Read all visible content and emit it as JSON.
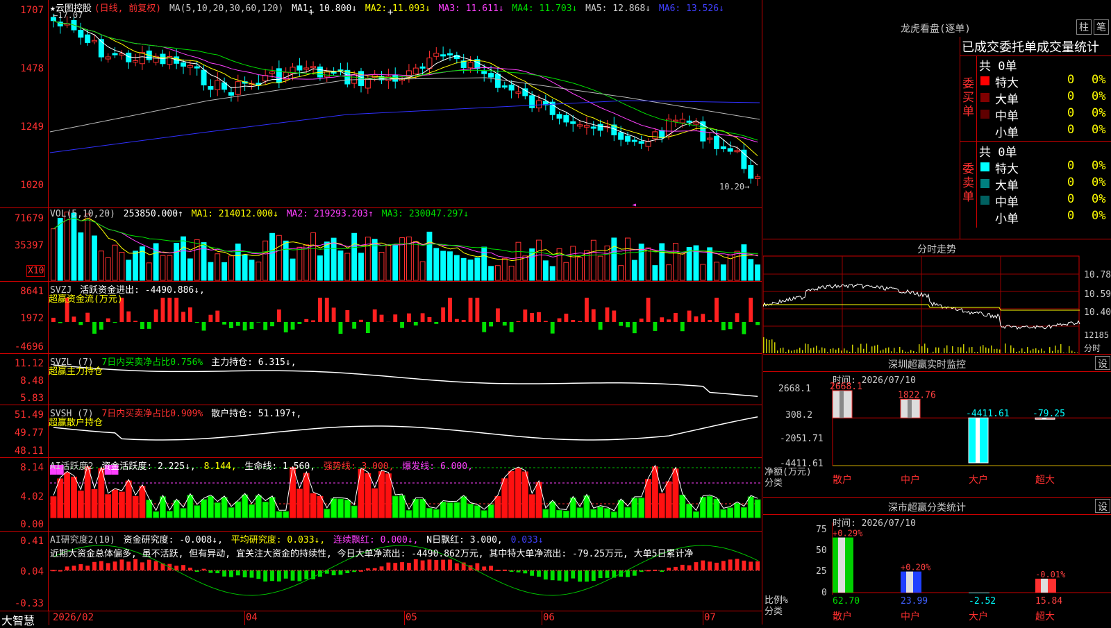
{
  "app": {
    "brand": "大智慧"
  },
  "kline": {
    "title": "★云图控股",
    "mode": "(日线, 前复权)",
    "ma_params": "MA(5,10,20,30,60,120)",
    "ma1": "MA1: 10.800↓",
    "ma2": "MA2: 11.093↓",
    "ma3": "MA3: 11.611↓",
    "ma4": "MA4: 11.703↓",
    "ma5": "MA5: 12.868↓",
    "ma6": "MA6: 13.526↓",
    "hi_mark": "←17.07",
    "lo_mark": "10.20→",
    "yticks": [
      "1707",
      "1478",
      "1249",
      "1020"
    ]
  },
  "vol": {
    "title": "VOL(5,10,20)",
    "value": "253850.000↑",
    "ma1": "MA1: 214012.000↓",
    "ma2": "MA2: 219293.203↑",
    "ma3": "MA3: 230047.297↓",
    "yticks": [
      "71679",
      "35397"
    ],
    "unit": "X10"
  },
  "svzj": {
    "title": "SVZJ",
    "label": "活跃资金进出: -4490.886↓,",
    "sub": "超赢资金流(万元)",
    "yticks": [
      "8641",
      "1972",
      "-4696"
    ]
  },
  "svzl": {
    "title": "SVZL (7)",
    "label1": "7日内买卖净占比0.756%",
    "label2": "主力持仓: 6.315↓,",
    "sub": "超赢主力持仓",
    "yticks": [
      "11.12",
      "8.48",
      "5.83"
    ]
  },
  "svsh": {
    "title": "SVSH (7)",
    "label1": "7日内买卖净占比0.909%",
    "label2": "散户持仓: 51.197↑,",
    "sub": "超赢散户持仓",
    "yticks": [
      "51.49",
      "49.77",
      "48.11"
    ]
  },
  "ai1": {
    "title": "AI活跃度2",
    "label": "资金活跃度: 2.225↓,",
    "v2": "8.144,",
    "life": "生命线: 1.560,",
    "strong": "强势线: 3.000,",
    "burst": "爆发线: 6.000,",
    "yticks": [
      "8.14",
      "4.02",
      "0.00"
    ]
  },
  "ai2": {
    "title": "AI研究度2(10)",
    "label": "资金研究度: -0.008↓,",
    "avg": "平均研究度: 0.033↓,",
    "lianx": "连续飘红: 0.000↓,",
    "nday": "N日飘红: 3.000,",
    "last": "0.033↓",
    "comment": "近期大资金总体偏多, 虽不活跃, 但有异动, 宜关注大资金的持续性, 今日大单净流出: -4490.862万元, 其中特大单净流出: -79.25万元, 大单5日累计净",
    "yticks": [
      "0.41",
      "0.04",
      "-0.33"
    ]
  },
  "xaxis": [
    "2026/02",
    "04",
    "05",
    "06",
    "07"
  ],
  "lhb": {
    "title": "龙虎看盘(逐单)",
    "btn1": "柱",
    "btn2": "笔",
    "header": "已成交委托单成交量统计",
    "buy": {
      "side": "委买单",
      "total": "共 0单",
      "rows": [
        {
          "name": "特大",
          "count": "0",
          "pct": "0%",
          "color": "#ff0000"
        },
        {
          "name": "大单",
          "count": "0",
          "pct": "0%",
          "color": "#800000"
        },
        {
          "name": "中单",
          "count": "0",
          "pct": "0%",
          "color": "#600000"
        },
        {
          "name": "小单",
          "count": "0",
          "pct": "0%",
          "color": "#000"
        }
      ]
    },
    "sell": {
      "side": "委卖单",
      "total": "共 0单",
      "rows": [
        {
          "name": "特大",
          "count": "0",
          "pct": "0%",
          "color": "#00ffff"
        },
        {
          "name": "大单",
          "count": "0",
          "pct": "0%",
          "color": "#008080"
        },
        {
          "name": "中单",
          "count": "0",
          "pct": "0%",
          "color": "#006060"
        },
        {
          "name": "小单",
          "count": "0",
          "pct": "0%",
          "color": "#000"
        }
      ]
    }
  },
  "fenshi": {
    "title": "分时走势",
    "ylabels": [
      "10.78",
      "10.59",
      "10.40"
    ],
    "vol": "12185",
    "unit": "分时"
  },
  "szmon": {
    "title": "深圳超赢实时监控",
    "btn": "设",
    "time": "时间: 2026/07/10",
    "ylabels": [
      "2668.1",
      "308.2",
      "-2051.71",
      "-4411.61"
    ],
    "ylabel": "净额(万元)",
    "xlabel": "分类",
    "cats": [
      "散户",
      "中户",
      "大户",
      "超大"
    ]
  },
  "szcls": {
    "title": "深市超赢分类统计",
    "btn": "设",
    "time": "时间: 2026/07/10",
    "ylabels": [
      "75",
      "50",
      "25",
      "0"
    ],
    "ylabel": "比例%",
    "xlabel": "分类",
    "cats": [
      "散户",
      "中户",
      "大户",
      "超大"
    ]
  },
  "chart_data": [
    {
      "type": "bar",
      "title": "深圳超赢实时监控",
      "ylabel": "净额(万元)",
      "xlabel": "分类",
      "categories": [
        "散户",
        "中户",
        "大户",
        "超大"
      ],
      "values": [
        2668.1,
        1822.76,
        -4411.61,
        -79.25
      ],
      "ylim": [
        -4411.61,
        2668.1
      ]
    },
    {
      "type": "bar",
      "title": "深市超赢分类统计",
      "ylabel": "比例%",
      "xlabel": "分类",
      "categories": [
        "散户",
        "中户",
        "大户",
        "超大"
      ],
      "values": [
        62.7,
        23.99,
        -2.52,
        15.84
      ],
      "pct_change": [
        "+0.29%",
        "+0.20%",
        "",
        "-0.01%"
      ],
      "ylim": [
        0,
        75
      ]
    }
  ]
}
